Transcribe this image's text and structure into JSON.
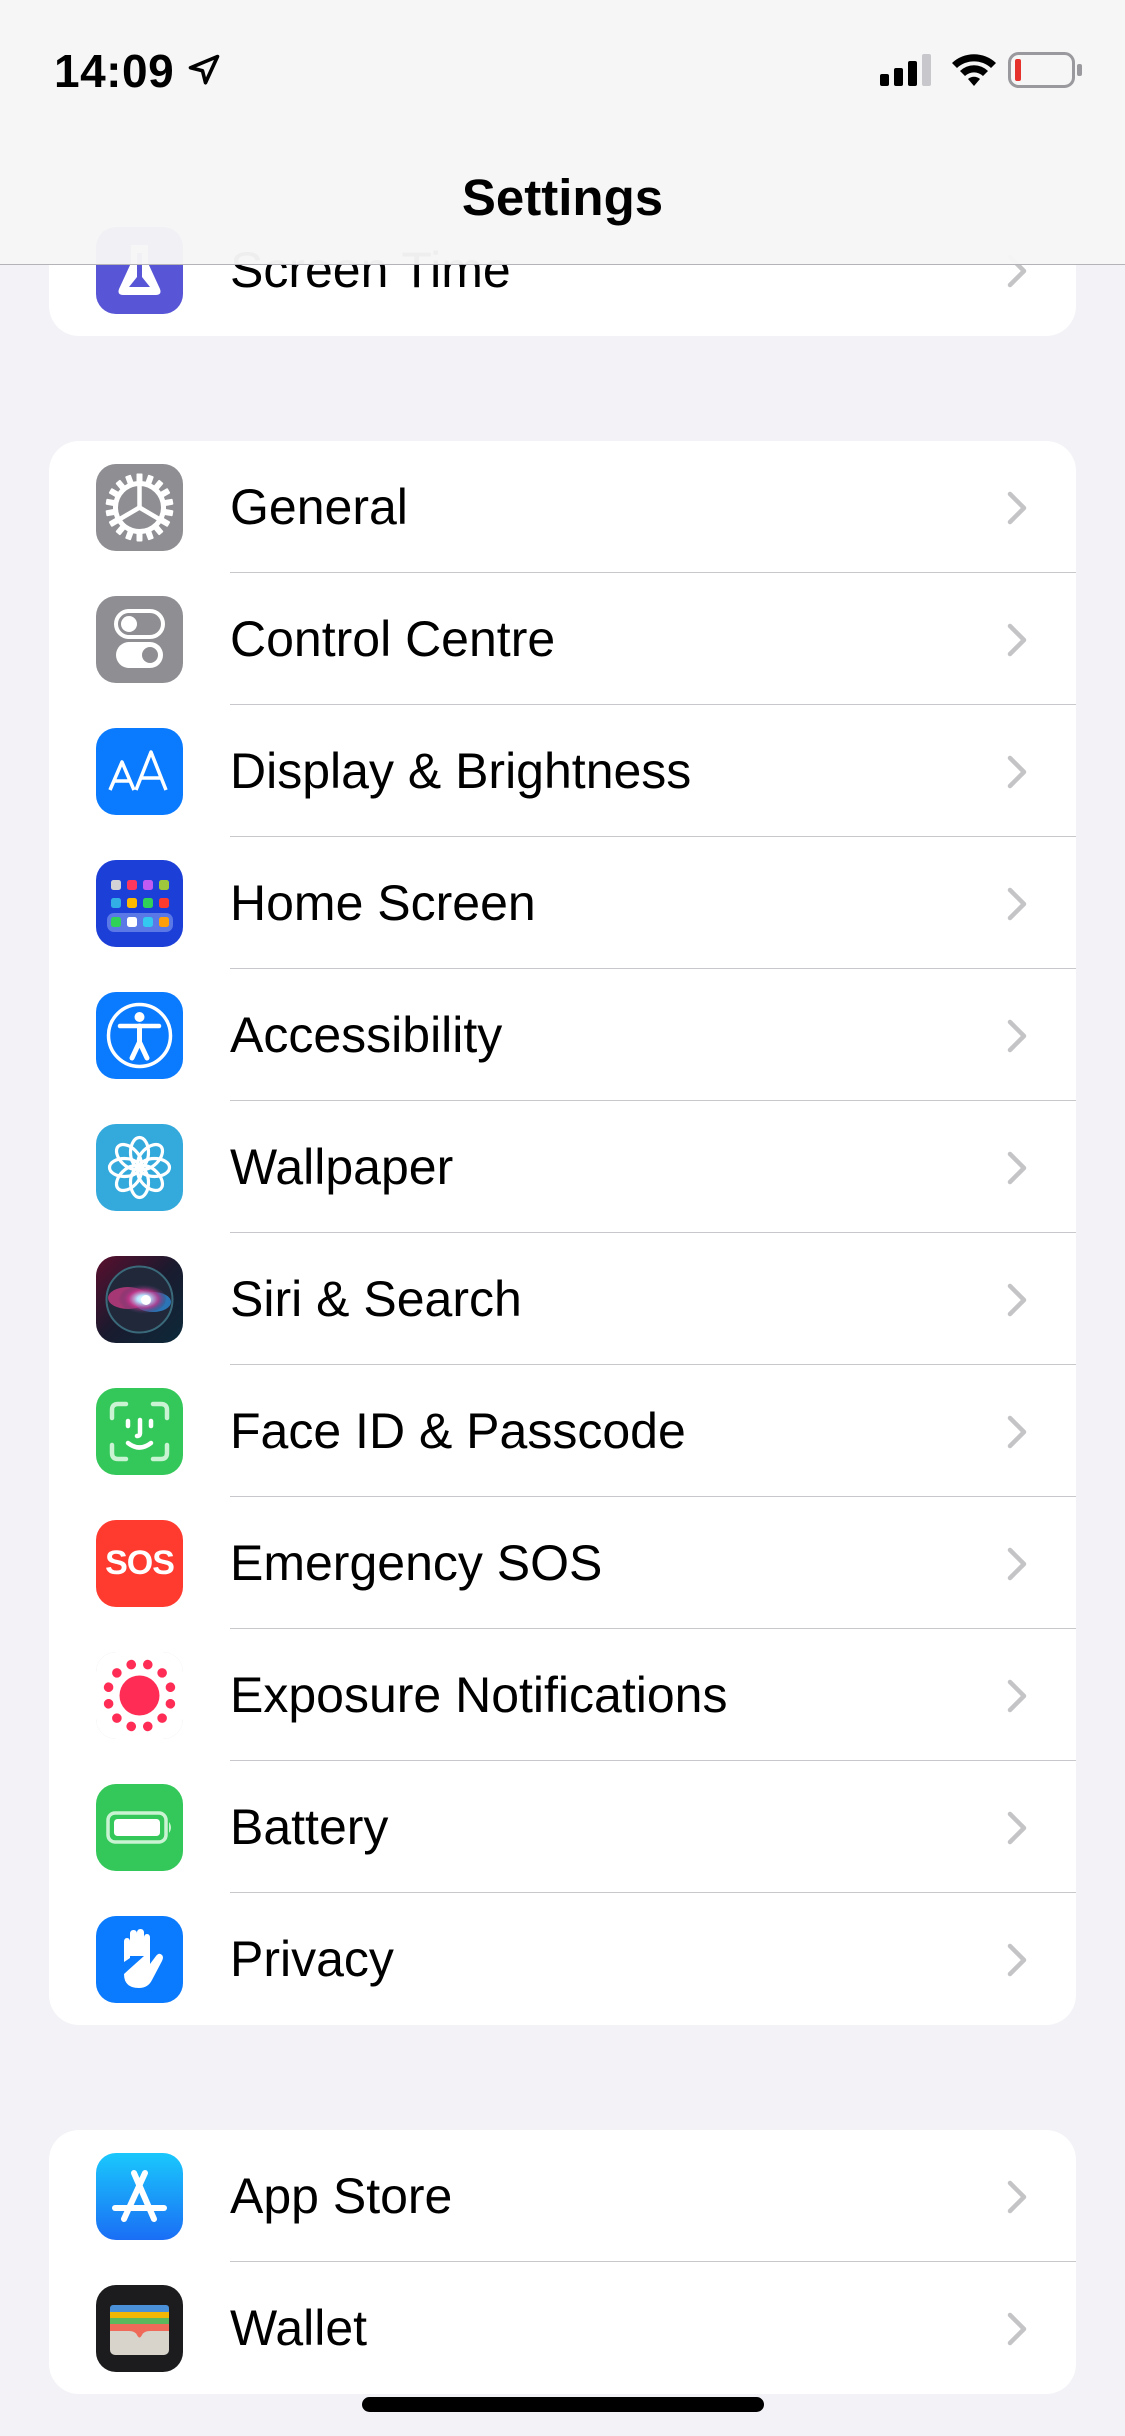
{
  "status_bar": {
    "time": "14:09",
    "location_services_active": true,
    "signal_bars": 3,
    "signal_bars_max": 4,
    "wifi": true,
    "battery_level": "low",
    "battery_color": "#e5322d"
  },
  "nav": {
    "title": "Settings"
  },
  "groups": [
    {
      "items": [
        {
          "label": "Screen Time",
          "icon": "hourglass-icon",
          "color": "#5856d6"
        }
      ]
    },
    {
      "items": [
        {
          "label": "General",
          "icon": "gear-icon",
          "color": "#8e8e93"
        },
        {
          "label": "Control Centre",
          "icon": "toggles-icon",
          "color": "#8e8e93"
        },
        {
          "label": "Display & Brightness",
          "icon": "text-size-icon",
          "color": "#0a7aff"
        },
        {
          "label": "Home Screen",
          "icon": "home-screen-grid-icon",
          "color": "#1c3fd8"
        },
        {
          "label": "Accessibility",
          "icon": "accessibility-icon",
          "color": "#0a7aff"
        },
        {
          "label": "Wallpaper",
          "icon": "flower-icon",
          "color": "#34aadc"
        },
        {
          "label": "Siri & Search",
          "icon": "siri-icon",
          "color": "#1a1a2e"
        },
        {
          "label": "Face ID & Passcode",
          "icon": "face-id-icon",
          "color": "#34c759"
        },
        {
          "label": "Emergency SOS",
          "icon": "sos-icon",
          "color": "#ff3b30",
          "icon_text": "SOS"
        },
        {
          "label": "Exposure Notifications",
          "icon": "exposure-icon",
          "color": "#ffffff"
        },
        {
          "label": "Battery",
          "icon": "battery-icon",
          "color": "#34c759"
        },
        {
          "label": "Privacy",
          "icon": "hand-icon",
          "color": "#0a7aff"
        }
      ]
    },
    {
      "items": [
        {
          "label": "App Store",
          "icon": "app-store-icon",
          "color": "#1a8cff"
        },
        {
          "label": "Wallet",
          "icon": "wallet-icon",
          "color": "#1c1c1e"
        }
      ]
    }
  ]
}
